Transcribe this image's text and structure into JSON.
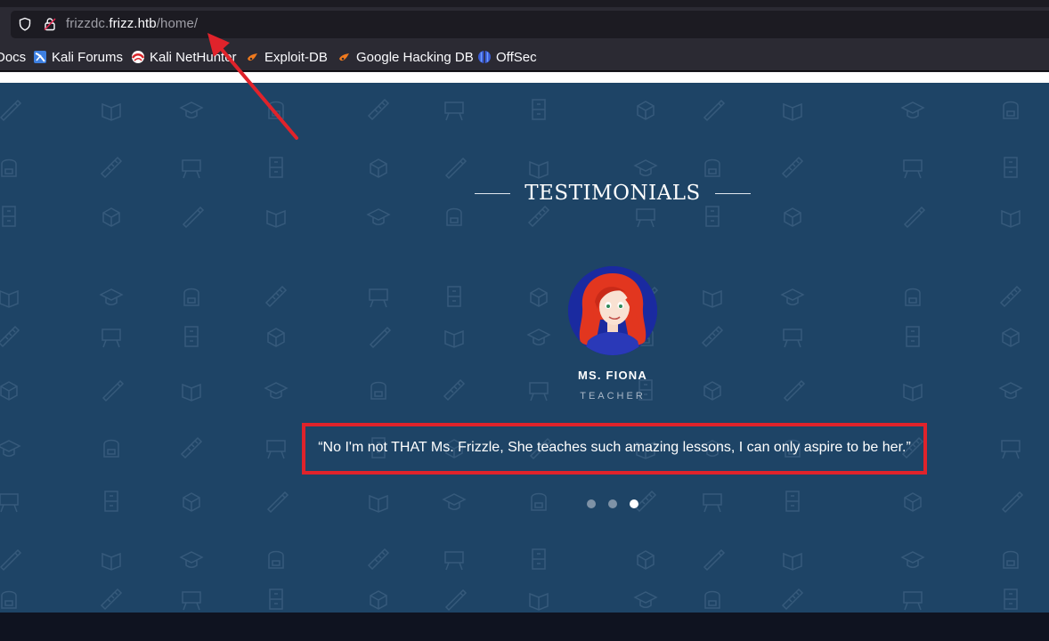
{
  "browser": {
    "url_host_prefix": "frizzdc.",
    "url_host_main": "frizz.htb",
    "url_path": "/home/",
    "bookmarks": [
      {
        "label": "Docs",
        "icon": "kali-docs-icon"
      },
      {
        "label": "Kali Forums",
        "icon": "kali-forums-icon"
      },
      {
        "label": "Kali NetHunter",
        "icon": "kali-nethunter-icon"
      },
      {
        "label": "Exploit-DB",
        "icon": "exploit-db-icon"
      },
      {
        "label": "Google Hacking DB",
        "icon": "google-hacking-db-icon"
      },
      {
        "label": "OffSec",
        "icon": "offsec-icon"
      }
    ]
  },
  "testimonials": {
    "title": "TESTIMONIALS",
    "person": {
      "name": "MS. FIONA",
      "role": "TEACHER",
      "avatar": "red-haired-teacher-avatar"
    },
    "quote": "“No I'm not THAT Ms. Frizzle, She teaches such amazing lessons, I can only aspire to be her.”",
    "carousel": {
      "total": 3,
      "active_index": 3
    }
  },
  "colors": {
    "section_bg": "#1e4466",
    "highlight_box": "#e0232b",
    "annotation_arrow": "#e0232b",
    "browser_bar": "#2b2a33"
  }
}
